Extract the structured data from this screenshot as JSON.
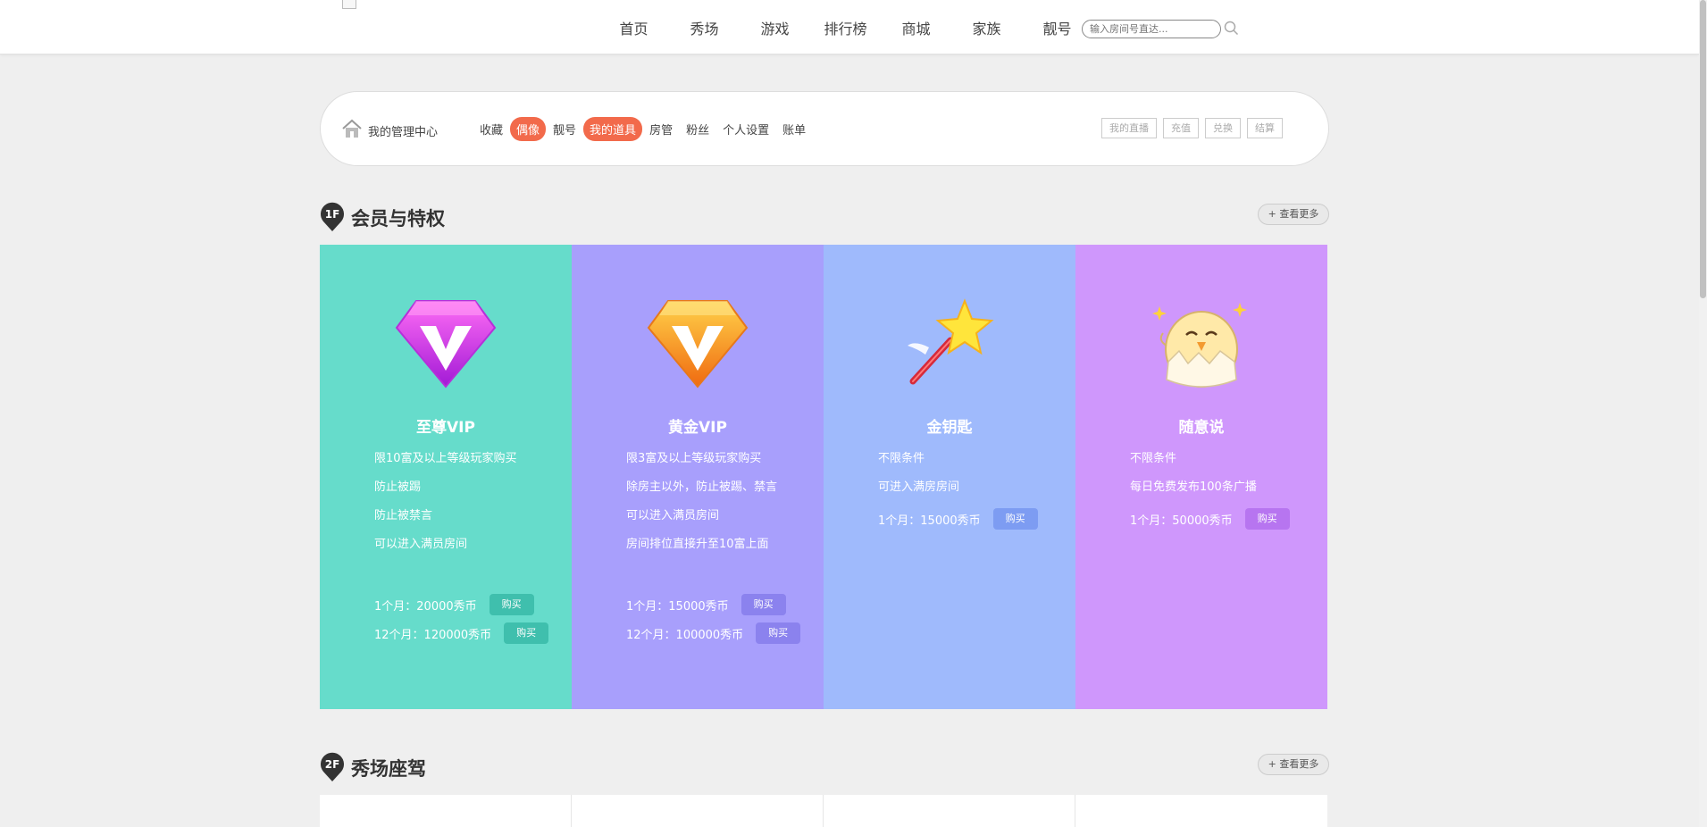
{
  "nav": {
    "items": [
      "首页",
      "秀场",
      "游戏",
      "排行榜",
      "商城",
      "家族",
      "靓号"
    ],
    "search_placeholder": "输入房间号直达..."
  },
  "panel": {
    "title": "我的管理中心",
    "links": [
      {
        "label": "收藏",
        "active": false
      },
      {
        "label": "偶像",
        "active": true
      },
      {
        "label": "靓号",
        "active": false
      },
      {
        "label": "我的道具",
        "active": true
      },
      {
        "label": "房管",
        "active": false
      },
      {
        "label": "粉丝",
        "active": false
      },
      {
        "label": "个人设置",
        "active": false
      },
      {
        "label": "账单",
        "active": false
      }
    ],
    "buttons": [
      "我的直播",
      "充值",
      "兑换",
      "结算"
    ]
  },
  "section1": {
    "badge": "1F",
    "title": "会员与特权",
    "more": "+ 查看更多"
  },
  "section2": {
    "badge": "2F",
    "title": "秀场座驾",
    "more": "+ 查看更多"
  },
  "cards": [
    {
      "title": "至尊VIP",
      "icon": "purple-diamond-v-icon",
      "bg": "#66dccb",
      "btn": "#3fbfad",
      "lines": [
        "限10富及以上等级玩家购买",
        "防止被踢",
        "防止被禁言",
        "可以进入满员房间"
      ],
      "prices": [
        {
          "label": "1个月：20000秀币",
          "buy": "购买"
        },
        {
          "label": "12个月：120000秀币",
          "buy": "购买"
        }
      ]
    },
    {
      "title": "黄金VIP",
      "icon": "orange-diamond-v-icon",
      "bg": "#a89ffc",
      "btn": "#8b82ee",
      "lines": [
        "限3富及以上等级玩家购买",
        "除房主以外，防止被踢、禁言",
        "可以进入满员房间",
        "房间排位直接升至10富上面"
      ],
      "prices": [
        {
          "label": "1个月：15000秀币",
          "buy": "购买"
        },
        {
          "label": "12个月：100000秀币",
          "buy": "购买"
        }
      ]
    },
    {
      "title": "金钥匙",
      "icon": "star-wand-icon",
      "bg": "#9fbafc",
      "btn": "#7d9cf2",
      "lines": [
        "不限条件",
        "可进入满房房间"
      ],
      "prices": [
        {
          "label": "1个月：15000秀币",
          "buy": "购买"
        }
      ]
    },
    {
      "title": "随意说",
      "icon": "chick-egg-icon",
      "bg": "#cf97fc",
      "btn": "#b775f0",
      "lines": [
        "不限条件",
        "每日免费发布100条广播"
      ],
      "prices": [
        {
          "label": "1个月：50000秀币",
          "buy": "购买"
        }
      ]
    }
  ]
}
